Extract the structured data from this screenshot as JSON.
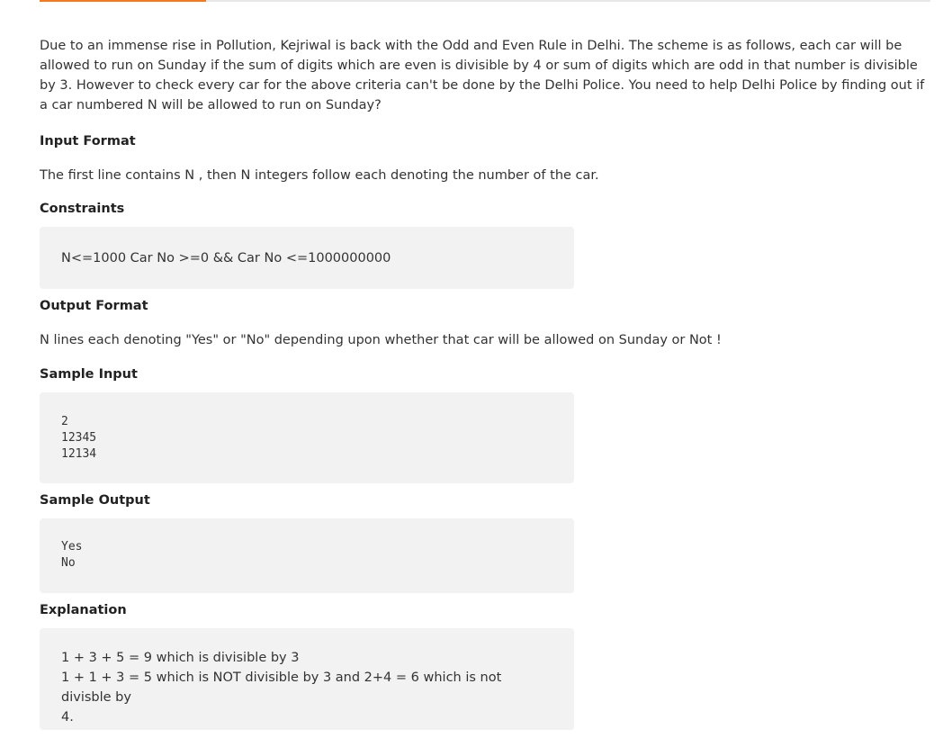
{
  "tabs": {
    "active_color": "#f47a20"
  },
  "problem": {
    "description": "Due to an immense rise in Pollution, Kejriwal is back with the Odd and Even Rule in Delhi. The scheme is as follows, each car will be allowed to run on Sunday if the sum of digits which are even is divisible by 4 or sum of digits which are odd in that number is divisible by 3. However to check every car for the above criteria can't be done by the Delhi Police. You need to help Delhi Police by finding out if a car numbered N will be allowed to run on Sunday?",
    "input_format": {
      "heading": "Input Format",
      "text": "The first line contains N , then N integers follow each denoting the number of the car."
    },
    "constraints": {
      "heading": "Constraints",
      "text": "N<=1000 Car No >=0 && Car No <=1000000000"
    },
    "output_format": {
      "heading": "Output Format",
      "text": "N lines each denoting \"Yes\" or \"No\" depending upon whether that car will be allowed on Sunday or Not !"
    },
    "sample_input": {
      "heading": "Sample Input",
      "lines": [
        "2",
        "12345",
        "12134"
      ]
    },
    "sample_output": {
      "heading": "Sample Output",
      "lines": [
        "Yes",
        "No"
      ]
    },
    "explanation": {
      "heading": "Explanation",
      "lines": [
        "1 + 3 + 5 = 9 which is divisible by 3",
        "1 + 1 + 3 = 5 which is NOT divisible by 3 and 2+4 = 6 which is not divisble by",
        "4."
      ]
    }
  }
}
